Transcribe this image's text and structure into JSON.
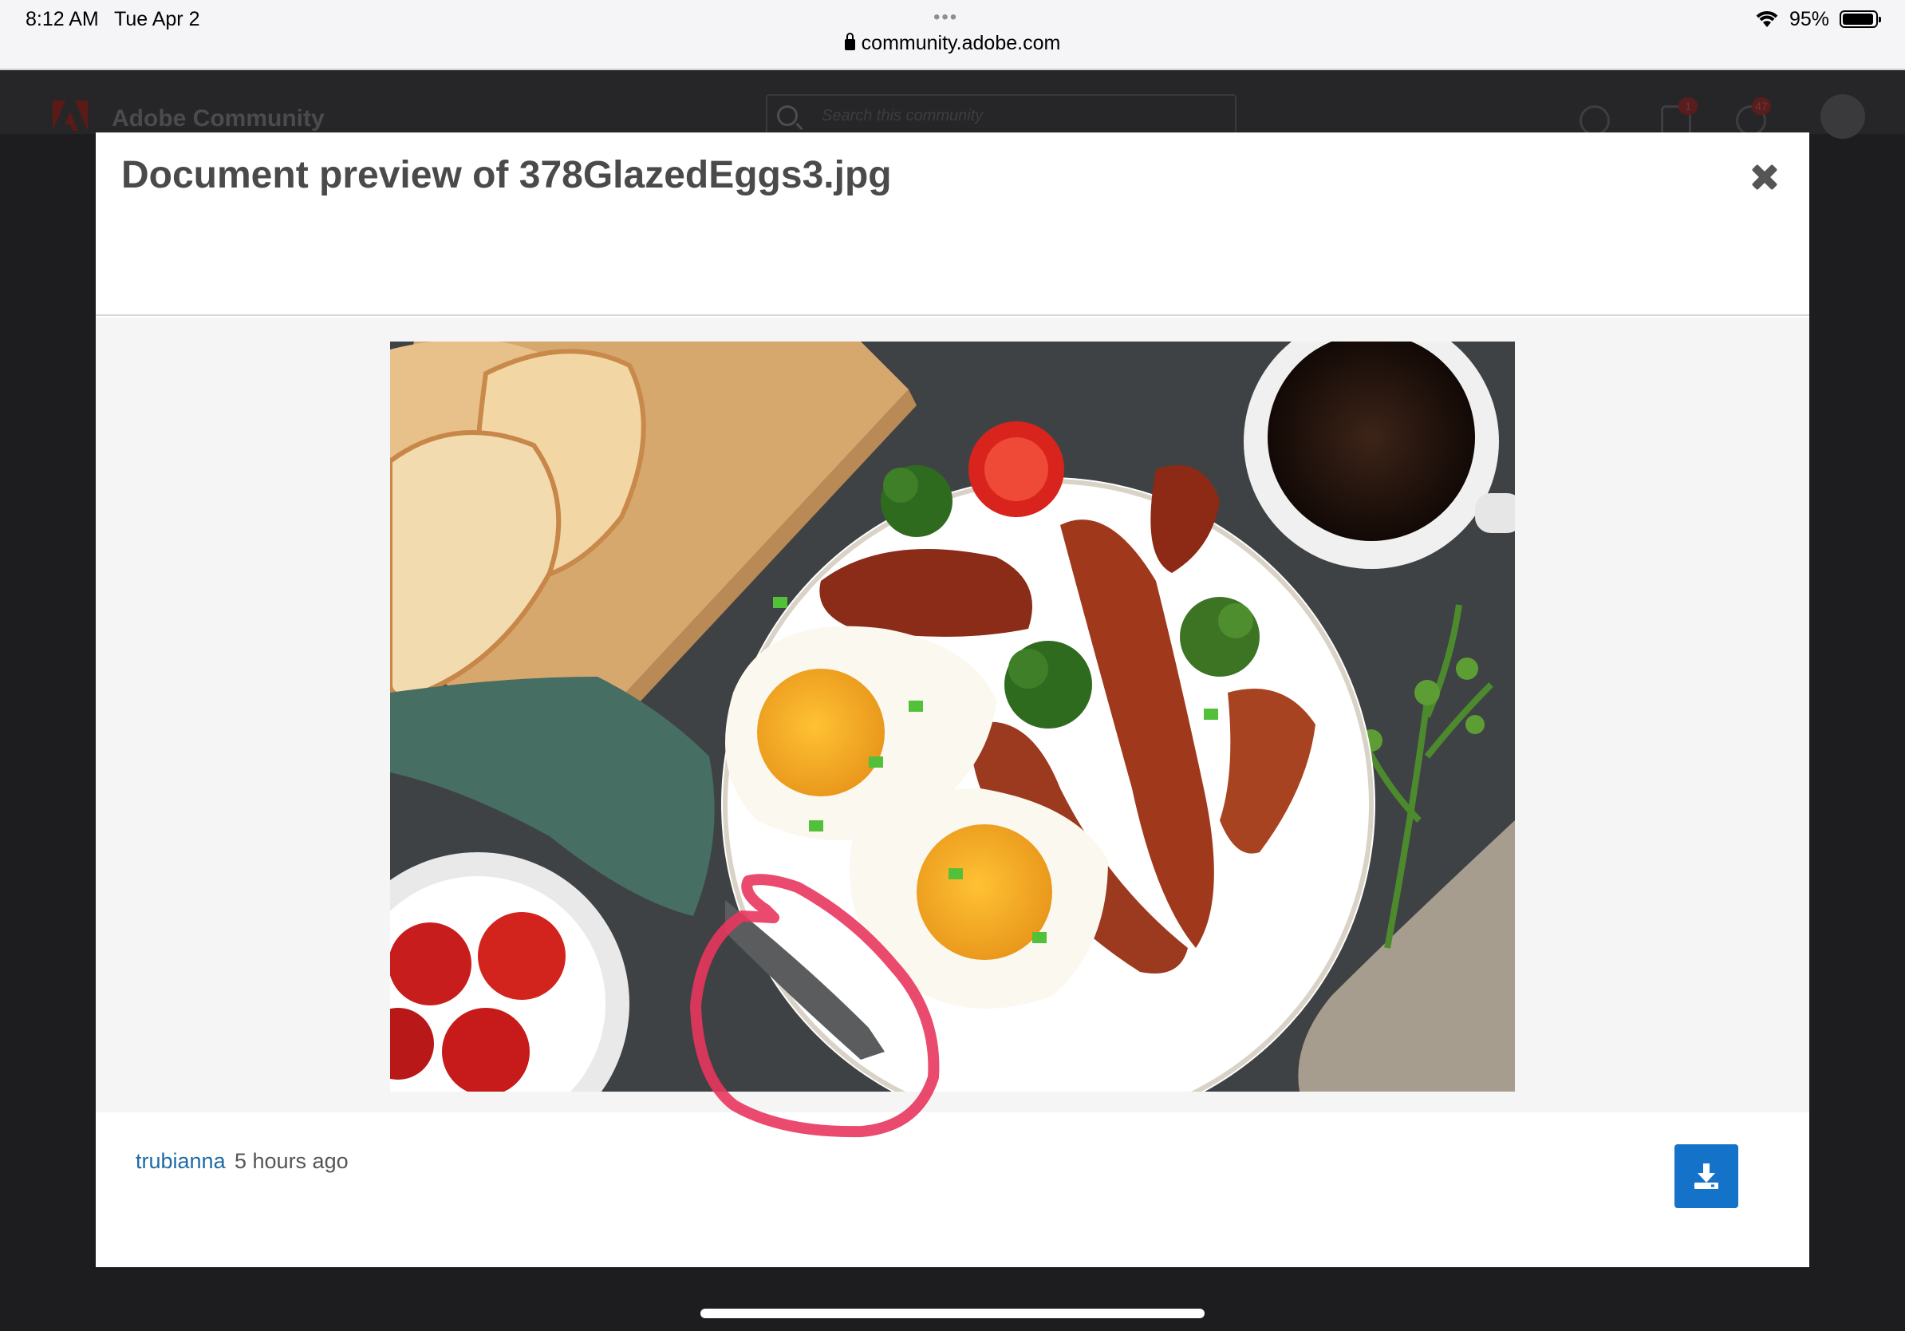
{
  "status_bar": {
    "time": "8:12 AM",
    "date": "Tue Apr 2",
    "url": "community.adobe.com",
    "battery": "95%",
    "icons": [
      "lock-icon",
      "wifi-icon",
      "battery-icon"
    ]
  },
  "site_header": {
    "title": "Adobe Community",
    "search_placeholder": "Search this community",
    "messages_badge": "1",
    "notifications_badge": "47"
  },
  "modal": {
    "title": "Document preview of 378GlazedEggs3.jpg",
    "close_icon": "close-icon",
    "image_description_icon": "photo",
    "author": "trubianna",
    "posted": "5 hours ago",
    "download_icon": "download-icon",
    "colors": {
      "author_link": "#1f6aa5",
      "download_button": "#1473c8",
      "annotation": "#e8365d"
    }
  }
}
